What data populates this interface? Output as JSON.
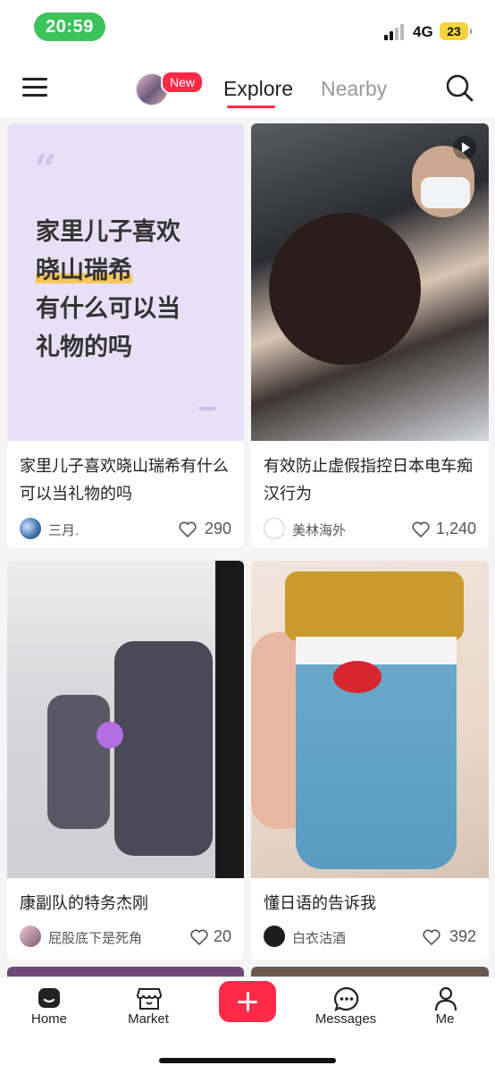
{
  "status_bar": {
    "time": "20:59",
    "network": "4G",
    "battery": "23"
  },
  "header": {
    "new_badge": "New",
    "tab_explore": "Explore",
    "tab_nearby": "Nearby"
  },
  "feed": [
    {
      "quote_lines": [
        "家里儿子喜欢",
        "晓山瑞希",
        "有什么可以当",
        "礼物的吗"
      ],
      "title": "家里儿子喜欢晓山瑞希有什么可以当礼物的吗",
      "author": "三月.",
      "likes": "290"
    },
    {
      "title": "有效防止虚假指控日本电车痴汉行为",
      "author": "美林海外",
      "likes": "1,240"
    },
    {
      "title": "康副队的特务杰刚",
      "author": "屁股底下是死角",
      "likes": "20"
    },
    {
      "title": "懂日语的告诉我",
      "author": "白衣沽酒",
      "likes": "392"
    }
  ],
  "bottom_nav": {
    "home": "Home",
    "market": "Market",
    "messages": "Messages",
    "me": "Me"
  },
  "colors": {
    "accent": "#ff2a48",
    "status_pill": "#3cc35a"
  },
  "icons": [
    "menu-icon",
    "search-icon",
    "heart-icon",
    "play-icon",
    "home-icon",
    "market-icon",
    "plus-icon",
    "messages-icon",
    "me-icon"
  ]
}
